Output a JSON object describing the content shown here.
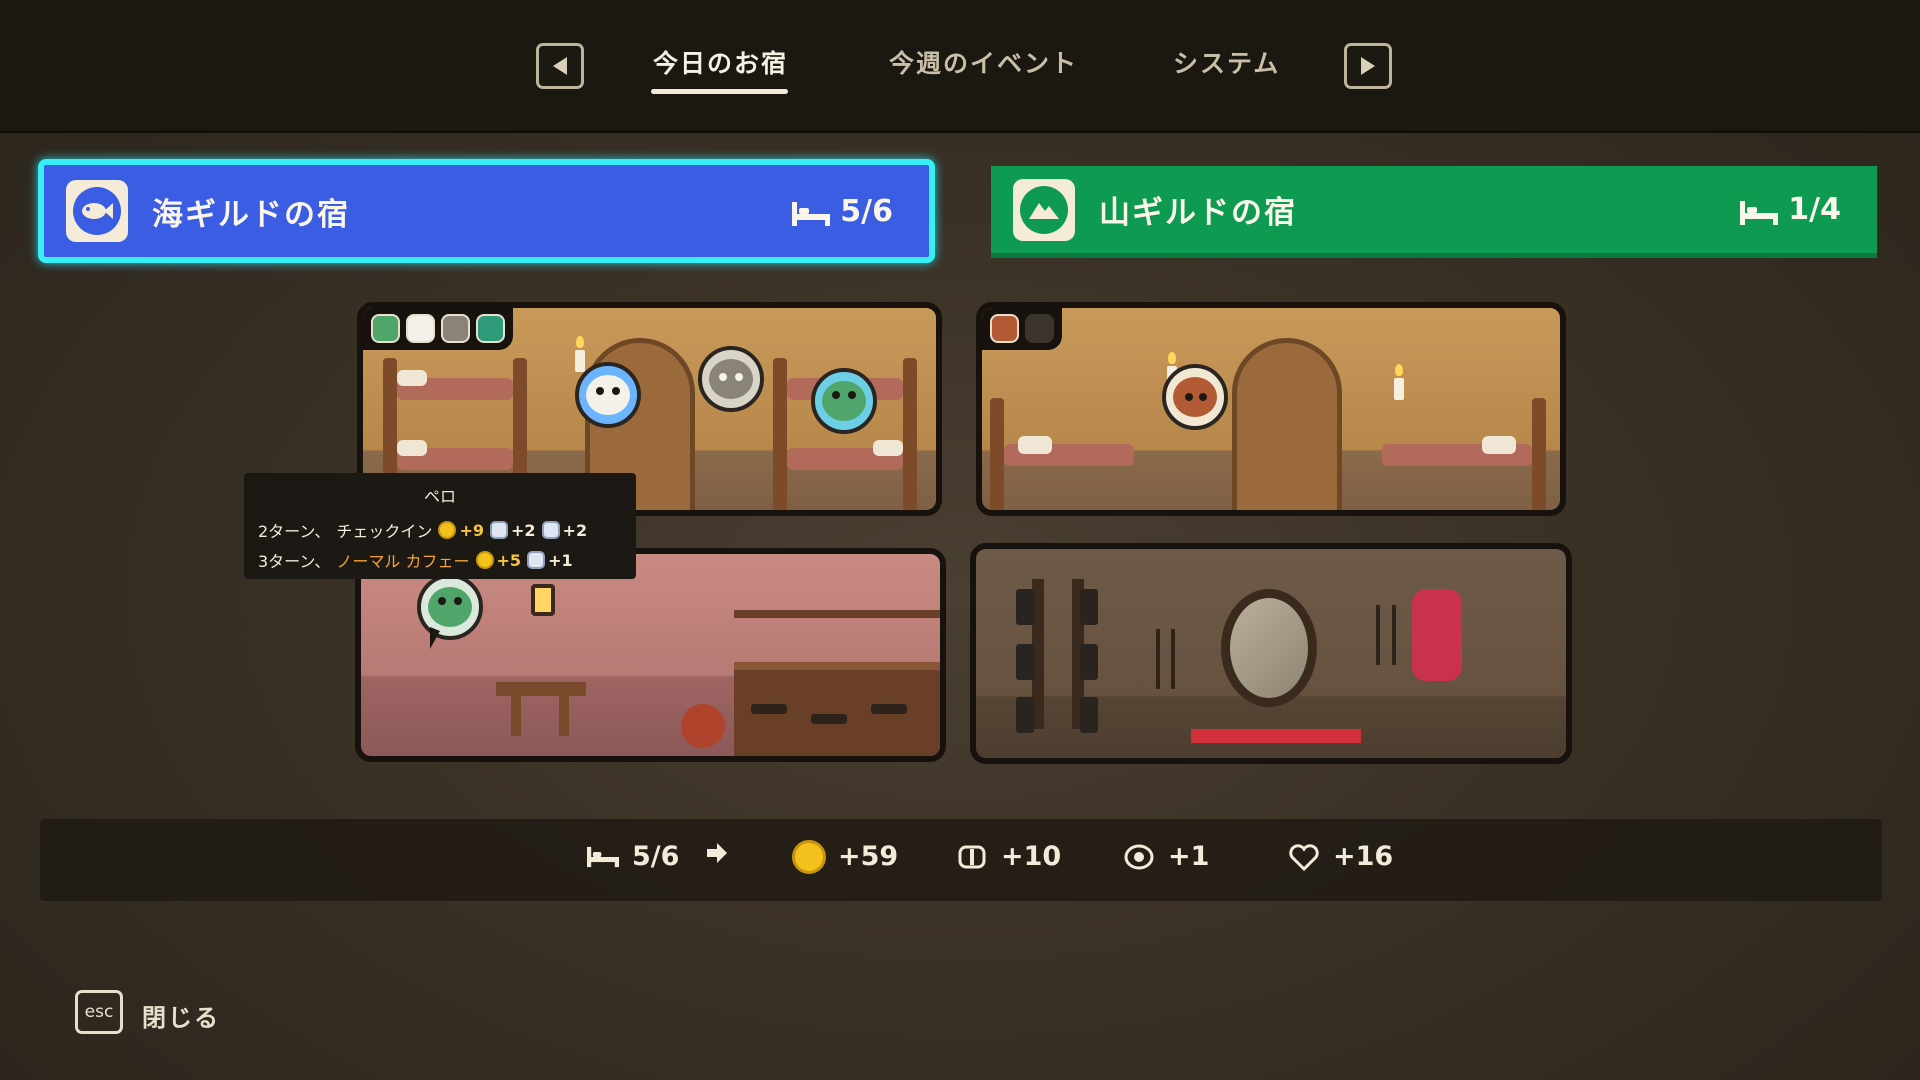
{
  "tabs": [
    {
      "label": "今日のお宿",
      "active": true
    },
    {
      "label": "今週のイベント",
      "active": false
    },
    {
      "label": "システム",
      "active": false
    }
  ],
  "inns": {
    "sea": {
      "name": "海ギルドの宿",
      "capacity": "5/6",
      "color": "#3b5de4",
      "icon": "fish-icon"
    },
    "mountain": {
      "name": "山ギルドの宿",
      "capacity": "1/4",
      "color": "#0f9a52",
      "icon": "mountain-icon"
    }
  },
  "tooltip": {
    "title": "ペロ",
    "row1": {
      "turns": "2ターン、",
      "action": "チェックイン",
      "coin": "+9",
      "stat_a": "+2",
      "stat_b": "+2"
    },
    "row2": {
      "turns": "3ターン、",
      "action": "ノーマル カフェー",
      "coin": "+5",
      "stat_b": "+1"
    }
  },
  "summary": {
    "capacity": "5/6",
    "coins": "+59",
    "stat_a": "+10",
    "stat_b": "+1",
    "stat_c": "+16"
  },
  "footer": {
    "key": "esc",
    "label": "閉じる"
  },
  "colors": {
    "accent_cyan": "#36f0f5",
    "coin": "#f2c11c",
    "sea": "#3b5de4",
    "mountain": "#0f9a52"
  }
}
